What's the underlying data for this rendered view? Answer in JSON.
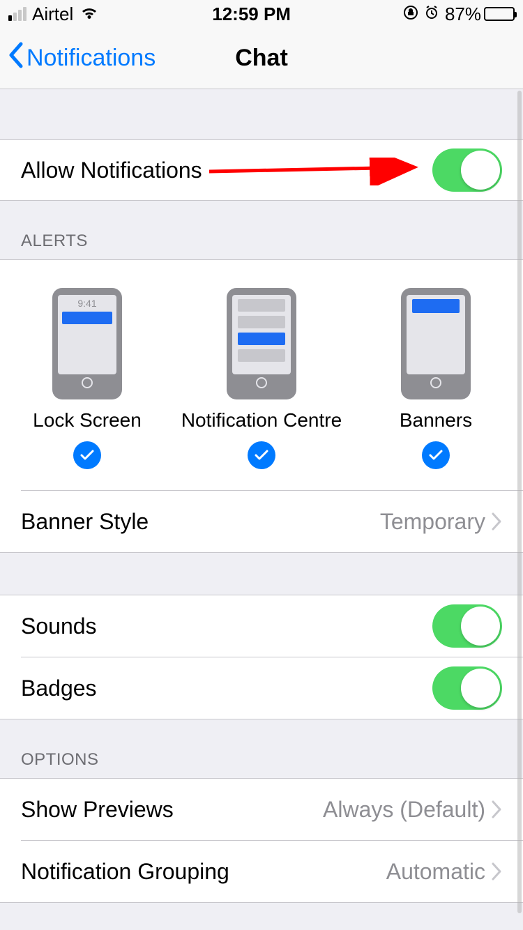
{
  "status": {
    "carrier": "Airtel",
    "time": "12:59 PM",
    "battery_pct": "87%"
  },
  "nav": {
    "back_label": "Notifications",
    "title": "Chat"
  },
  "allow": {
    "label": "Allow Notifications",
    "on": true
  },
  "alerts": {
    "header": "ALERTS",
    "preview_time": "9:41",
    "items": [
      {
        "label": "Lock Screen"
      },
      {
        "label": "Notification Centre"
      },
      {
        "label": "Banners"
      }
    ],
    "banner_style": {
      "label": "Banner Style",
      "value": "Temporary"
    }
  },
  "sounds": {
    "label": "Sounds",
    "on": true
  },
  "badges": {
    "label": "Badges",
    "on": true
  },
  "options": {
    "header": "OPTIONS",
    "previews": {
      "label": "Show Previews",
      "value": "Always (Default)"
    },
    "grouping": {
      "label": "Notification Grouping",
      "value": "Automatic"
    }
  }
}
